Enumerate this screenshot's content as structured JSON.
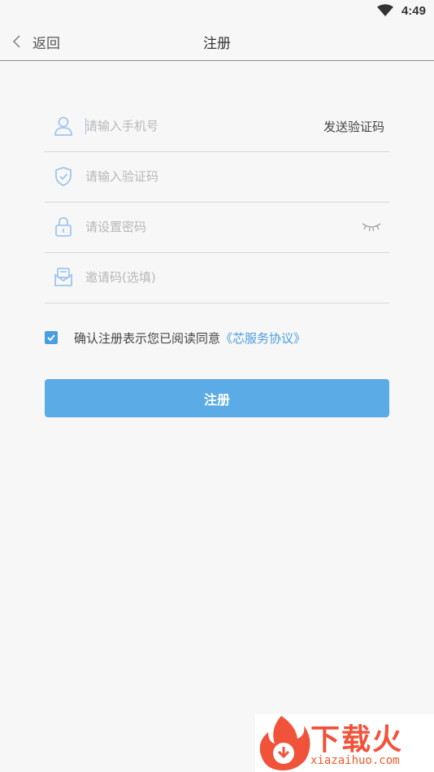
{
  "status_bar": {
    "time": "4:49"
  },
  "nav": {
    "back_label": "返回",
    "title": "注册"
  },
  "form": {
    "phone_placeholder": "请输入手机号",
    "send_code_label": "发送验证码",
    "code_placeholder": "请输入验证码",
    "password_placeholder": "请设置密码",
    "invite_placeholder": "邀请码(选填)"
  },
  "agreement": {
    "checked": true,
    "text": "确认注册表示您已阅读同意",
    "link_text": "《芯服务协议》"
  },
  "register_button_label": "注册",
  "watermark": {
    "brand": "下载火",
    "url": "xiazaihuo.com"
  },
  "colors": {
    "accent": "#4a9ee0",
    "button": "#5aabe6",
    "icon": "#9fc5f0",
    "watermark": "#f1523a"
  }
}
